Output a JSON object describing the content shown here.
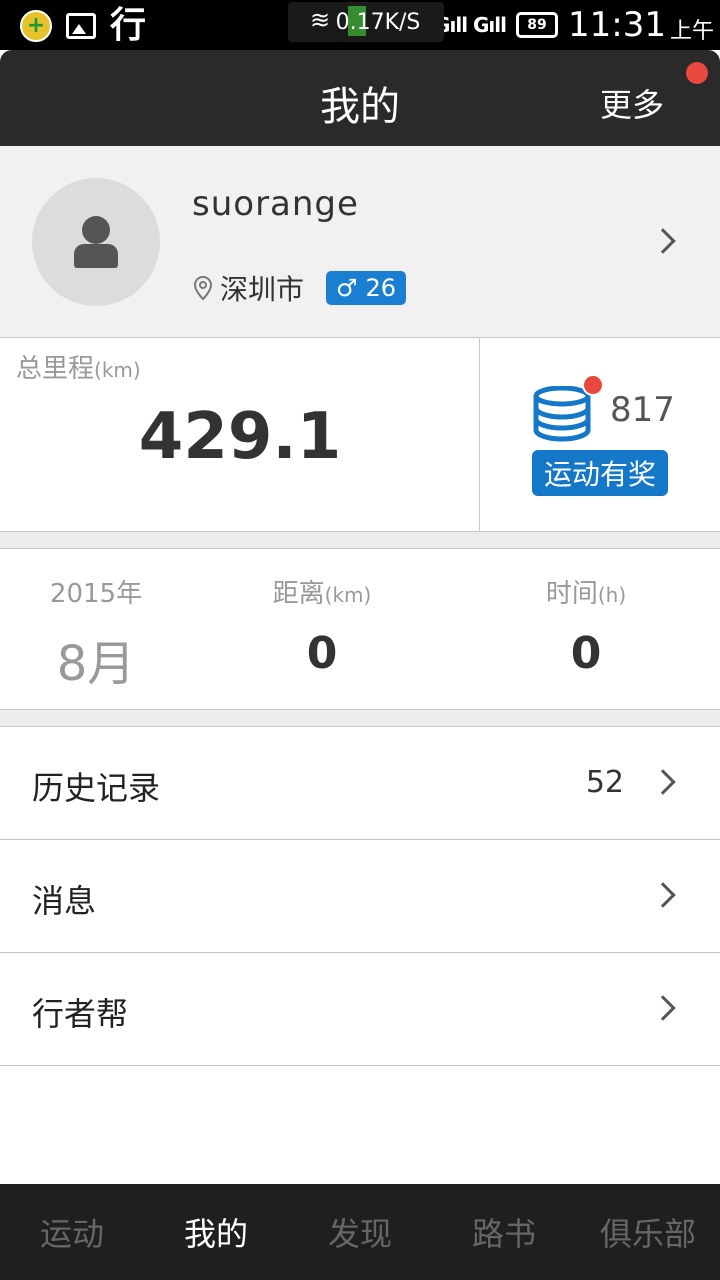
{
  "status_bar": {
    "app_char": "行",
    "battery": "89",
    "network": "3G",
    "time": "11:31",
    "ampm": "上午",
    "speed": "0.17K/S"
  },
  "header": {
    "title": "我的",
    "more": "更多"
  },
  "profile": {
    "username": "suorange",
    "city": "深圳市",
    "gender_symbol": "♂",
    "age": "26"
  },
  "stats": {
    "total_label": "总里程",
    "total_unit": "(km)",
    "total_value": "429.1",
    "coins": "817",
    "reward_button": "运动有奖"
  },
  "monthly": {
    "year": "2015年",
    "month": "8月",
    "distance_label": "距离",
    "distance_unit": "(km)",
    "distance_value": "0",
    "time_label": "时间",
    "time_unit": "(h)",
    "time_value": "0"
  },
  "list": {
    "history_label": "历史记录",
    "history_count": "52",
    "messages_label": "消息",
    "walkers_label": "行者帮"
  },
  "nav": {
    "items": [
      "运动",
      "我的",
      "发现",
      "路书",
      "俱乐部"
    ]
  },
  "colors": {
    "accent_blue": "#1477c8",
    "notification_red": "#e9483f",
    "header_bg": "#2a2a2a"
  }
}
